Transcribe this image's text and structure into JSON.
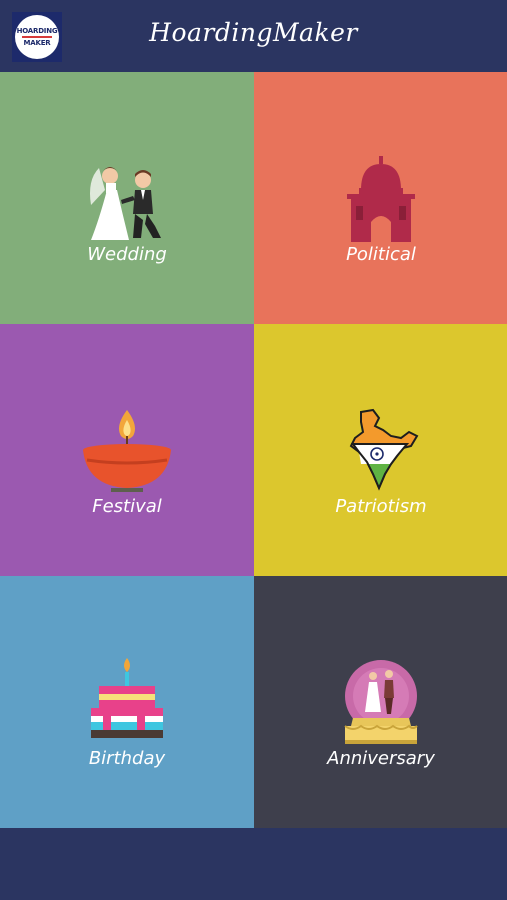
{
  "header": {
    "title": "HoardingMaker",
    "logo_text_line1": "HOARDING",
    "logo_text_line2": "MAKER"
  },
  "categories": [
    {
      "label": "Wedding",
      "icon": "wedding-couple-icon",
      "color": "#82ae7a"
    },
    {
      "label": "Political",
      "icon": "parliament-icon",
      "color": "#e8735b"
    },
    {
      "label": "Festival",
      "icon": "diya-lamp-icon",
      "color": "#9b59b0"
    },
    {
      "label": "Patriotism",
      "icon": "india-map-icon",
      "color": "#dcc72d"
    },
    {
      "label": "Birthday",
      "icon": "birthday-cake-icon",
      "color": "#5fa0c6"
    },
    {
      "label": "Anniversary",
      "icon": "anniversary-globe-icon",
      "color": "#3e3f4c"
    }
  ],
  "colors": {
    "header_bg": "#2b3561",
    "footer_bg": "#2b3561"
  }
}
